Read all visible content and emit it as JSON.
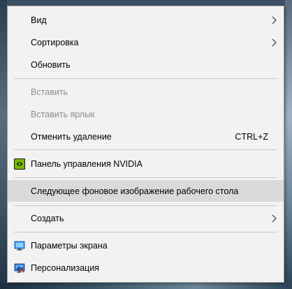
{
  "menu": {
    "items": [
      {
        "label": "Вид",
        "submenu": true
      },
      {
        "label": "Сортировка",
        "submenu": true
      },
      {
        "label": "Обновить"
      },
      {
        "label": "Вставить",
        "disabled": true
      },
      {
        "label": "Вставить ярлык",
        "disabled": true
      },
      {
        "label": "Отменить удаление",
        "shortcut": "CTRL+Z"
      },
      {
        "label": "Панель управления NVIDIA",
        "icon": "nvidia-icon"
      },
      {
        "label": "Следующее фоновое изображение рабочего стола",
        "highlighted": true
      },
      {
        "label": "Создать",
        "submenu": true
      },
      {
        "label": "Параметры экрана",
        "icon": "display-settings-icon"
      },
      {
        "label": "Персонализация",
        "icon": "personalization-icon"
      }
    ]
  },
  "colors": {
    "menu_bg": "#f2f2f2",
    "hover_bg": "#dadada",
    "disabled_text": "#8c8c8c",
    "nvidia_green": "#76b900",
    "display_blue": "#1e90ff"
  }
}
